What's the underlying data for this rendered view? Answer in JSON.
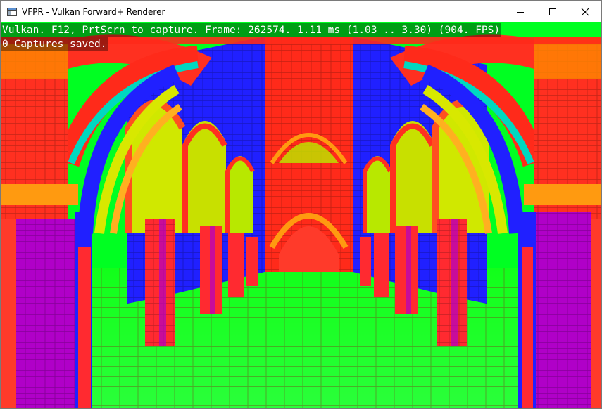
{
  "window": {
    "title": "VFPR - Vulkan Forward+ Renderer",
    "icon": "app-window-icon"
  },
  "controls": {
    "minimize": "minimize-icon",
    "maximize": "maximize-icon",
    "close": "close-icon"
  },
  "overlay": {
    "status_line": "Vulkan. F12, PrtScrn to capture. Frame: 262574. 1.11 ms (1.03 .. 3.30) (904. FPS)",
    "captures_line": "0 Captures saved."
  },
  "colors": {
    "floor": "#00ff22",
    "red": "#ff2a1a",
    "blue": "#1a1aff",
    "magenta": "#b000c8",
    "orange": "#ff8a00",
    "yellow": "#d8e800",
    "cyan": "#00d8c0"
  }
}
